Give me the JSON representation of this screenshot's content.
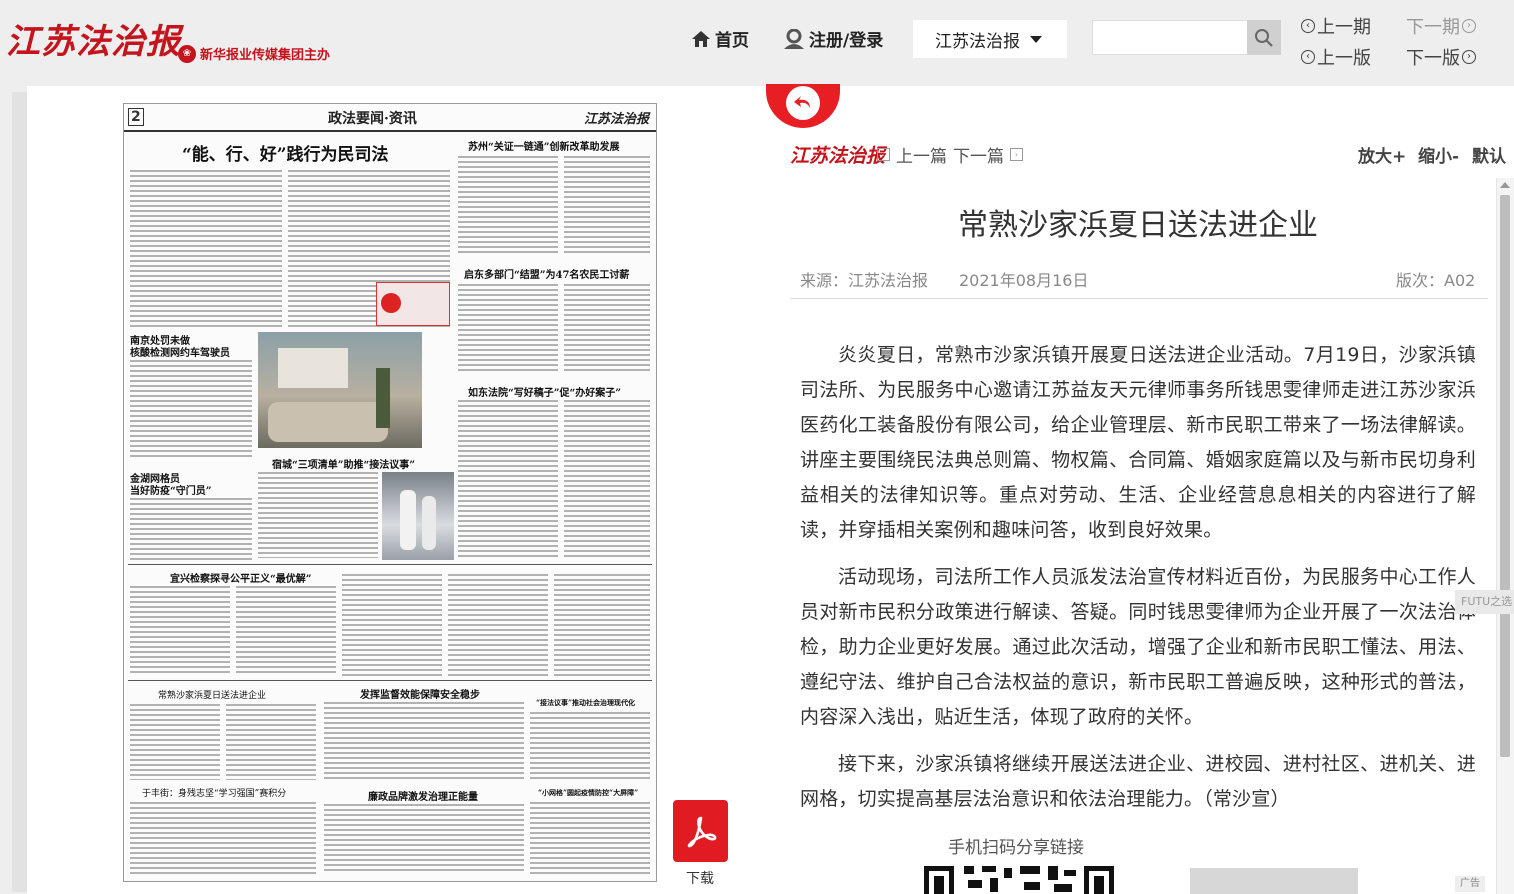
{
  "header": {
    "logo_text": "江苏法治报",
    "sponsor_text": "新华报业传媒集团主办",
    "nav": {
      "home": "首页",
      "login": "注册/登录",
      "paper_select": "江苏法治报"
    },
    "search": {
      "value": ""
    },
    "issue_nav": {
      "prev_issue": "上一期",
      "next_issue": "下一期",
      "prev_page": "上一版",
      "next_page": "下一版"
    }
  },
  "newspaper": {
    "page_no": "2",
    "section": "政法要闻·资讯",
    "logo": "江苏法治报",
    "headlines": {
      "h1": "“能、行、好”践行为民司法",
      "h2": "苏州“关证一链通”创新改革助发展",
      "h3": "启东多部门“结盟”为47名农民工讨薪",
      "h4a": "南京处罚未做",
      "h4b": "核酸检测网约车驾驶员",
      "h5": "如东法院“写好稿子”促“办好案子”",
      "h6": "宿城“三项清单”助推“接法议事”",
      "h7a": "金湖网格员",
      "h7b": "当好防疫“守门员”",
      "h8": "宜兴检察探寻公平正义“最优解”",
      "h9": "常熟沙家浜夏日送法进企业",
      "h10": "发挥监督效能保障安全稳步",
      "h11": "“接法议事”推动社会治理现代化",
      "h12": "于丰街：身残志坚“学习强国”赛积分",
      "h13": "廉政品牌激发治理正能量",
      "h14": "“小网格”圆起疫情防控“大屏障”"
    }
  },
  "download_label": "下载",
  "article": {
    "logo": "江苏法治报",
    "prev": "上一篇",
    "next": "下一篇",
    "zoom_in": "放大+",
    "zoom_out": "缩小-",
    "zoom_default": "默认",
    "title": "常熟沙家浜夏日送法进企业",
    "source": "来源：江苏法治报",
    "date": "2021年08月16日",
    "edition": "版次：A02",
    "paragraphs": [
      "炎炎夏日，常熟市沙家浜镇开展夏日送法进企业活动。7月19日，沙家浜镇司法所、为民服务中心邀请江苏益友天元律师事务所钱思雯律师走进江苏沙家浜医药化工装备股份有限公司，给企业管理层、新市民职工带来了一场法律解读。讲座主要围绕民法典总则篇、物权篇、合同篇、婚姻家庭篇以及与新市民切身利益相关的法律知识等。重点对劳动、生活、企业经营息息相关的内容进行了解读，并穿插相关案例和趣味问答，收到良好效果。",
      "活动现场，司法所工作人员派发法治宣传材料近百份，为民服务中心工作人员对新市民积分政策进行解读、答疑。同时钱思雯律师为企业开展了一次法治体检，助力企业更好发展。通过此次活动，增强了企业和新市民职工懂法、用法、遵纪守法、维护自己合法权益的意识，新市民职工普遍反映，这种形式的普法，内容深入浅出，贴近生活，体现了政府的关怀。",
      "接下来，沙家浜镇将继续开展送法进企业、进校园、进村社区、进机关、进网格，切实提高基层法治意识和依法治理能力。（常沙宣）"
    ],
    "qr_label": "手机扫码分享链接"
  },
  "side": {
    "float_tab": "FUTU之选",
    "ad_tag": "广告"
  },
  "colors": {
    "brand_red": "#c4141c",
    "back_red": "#e81e25",
    "pdf_red": "#e01b22"
  }
}
